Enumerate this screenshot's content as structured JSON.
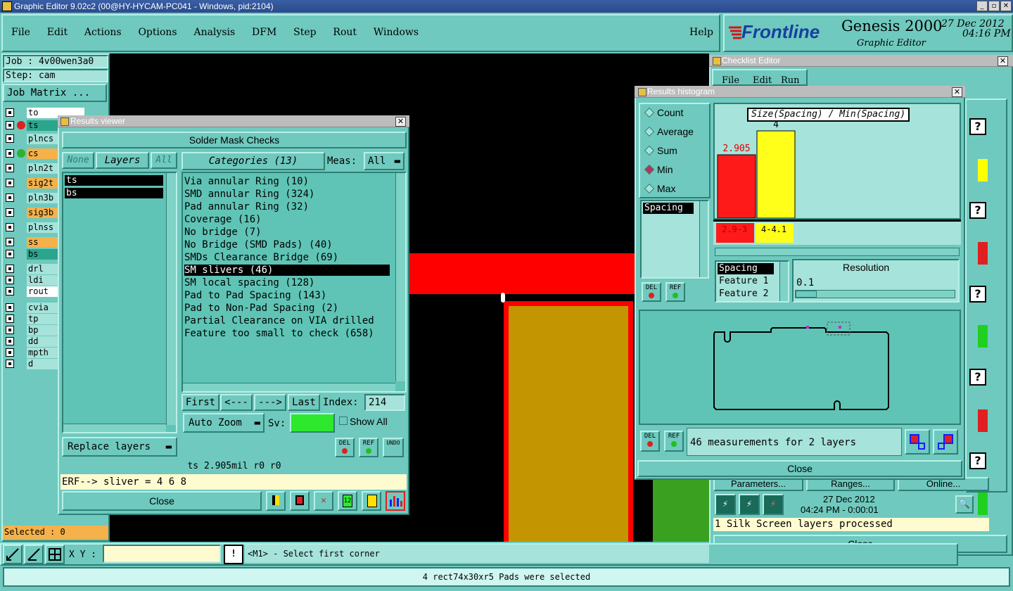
{
  "app": {
    "title": "Graphic Editor 9.02c2 (00@HY-HYCAM-PC041 - Windows, pid:2104)",
    "menu": [
      "File",
      "Edit",
      "Actions",
      "Options",
      "Analysis",
      "DFM",
      "Step",
      "Rout",
      "Windows"
    ],
    "help": "Help",
    "brand": "Frontline",
    "product": "Genesis 2000",
    "subtitle": "Graphic Editor",
    "date": "27 Dec 2012",
    "time": "04:16 PM"
  },
  "left_panel": {
    "job": "Job : 4v00wen3a0",
    "step": "Step: cam",
    "job_matrix": "Job Matrix ...",
    "layers": [
      {
        "name": "to",
        "color": "#ffffff"
      },
      {
        "name": "ts",
        "color": "#2ca58d"
      },
      {
        "name": "plncs",
        "color": "#a6e3da"
      },
      {
        "name": "cs",
        "color": "#f5b14a"
      },
      {
        "name": "pln2t",
        "color": "#a6e3da"
      },
      {
        "name": "sig2t",
        "color": "#f5b14a"
      },
      {
        "name": "pln3b",
        "color": "#a6e3da"
      },
      {
        "name": "sig3b",
        "color": "#f5b14a"
      },
      {
        "name": "plnss",
        "color": "#a6e3da"
      },
      {
        "name": "ss",
        "color": "#f5b14a"
      },
      {
        "name": "bs",
        "color": "#2ca58d"
      },
      {
        "name": "drl",
        "color": "#a6e3da"
      },
      {
        "name": "ldi",
        "color": "#a6e3da"
      },
      {
        "name": "rout",
        "color": "#ffffff"
      },
      {
        "name": "cvia",
        "color": "#a6e3da"
      },
      {
        "name": "tp",
        "color": "#a6e3da"
      },
      {
        "name": "bp",
        "color": "#a6e3da"
      },
      {
        "name": "dd",
        "color": "#a6e3da"
      },
      {
        "name": "mpth",
        "color": "#a6e3da"
      },
      {
        "name": "d",
        "color": "#a6e3da"
      }
    ],
    "selected": "Selected : 0"
  },
  "results_viewer": {
    "title": "Results viewer",
    "header": "Solder Mask Checks",
    "none_btn": "None",
    "layers_btn": "Layers",
    "all_btn": "All",
    "layers": [
      "ts",
      "bs"
    ],
    "categories_btn": "Categories (13)",
    "meas_label": "Meas:",
    "meas_value": "All",
    "categories": [
      "Via annular Ring (10)",
      "SMD annular Ring (324)",
      "Pad annular Ring (32)",
      "Coverage (16)",
      "No bridge (7)",
      "No Bridge (SMD Pads) (40)",
      "SMDs Clearance Bridge (69)",
      "SM slivers (46)",
      "SM local spacing (128)",
      "Pad to Pad Spacing (143)",
      "Pad to Non-Pad Spacing (2)",
      "Partial Clearance on VIA drilled",
      "Feature too small to check (658)"
    ],
    "selected_category": 7,
    "first": "First",
    "prev": "<---",
    "next": "--->",
    "last": "Last",
    "index_label": "Index:",
    "index_value": "214",
    "auto_zoom": "Auto Zoom",
    "sv_label": "Sv:",
    "show_all": "Show All",
    "replace_layers": "Replace layers",
    "del": "DEL",
    "ref": "REF",
    "undo": "UNDO",
    "status": "ts 2.905mil  r0  r0",
    "erf": "ERF--> sliver = 4 6 8",
    "close": "Close"
  },
  "histogram": {
    "title": "Results histogram",
    "modes": [
      "Count",
      "Average",
      "Sum",
      "Min",
      "Max"
    ],
    "selected_mode": "Min",
    "list_item": "Spacing",
    "chart_title": "Size(Spacing) / Min(Spacing)",
    "bars": [
      {
        "label": "2.905",
        "range": "2.9-3",
        "value": 2.905,
        "color": "#ff1a1a"
      },
      {
        "label": "4",
        "range": "4-4.1",
        "value": 4,
        "color": "#ffff1a"
      }
    ],
    "fields": [
      "Spacing",
      "Feature 1",
      "Feature 2"
    ],
    "resolution_label": "Resolution",
    "resolution_value": "0.1",
    "measurements": "46 measurements for 2 layers",
    "del": "DEL",
    "ref": "REF",
    "close": "Close"
  },
  "checklist": {
    "title": "Checklist Editor",
    "menu": [
      "File",
      "Edit",
      "Run"
    ],
    "parameters": "Parameters...",
    "ranges": "Ranges...",
    "online": "Online...",
    "date": "27 Dec 2012",
    "time": "04:24 PM - 0:00:01",
    "status": "1 Silk Screen layers processed",
    "close": "Close"
  },
  "bottom": {
    "xy_label": "X Y :",
    "xy_value": "",
    "prompt": "<M1> - Select first corner",
    "status": "4 rect74x30xr5 Pads were selected"
  }
}
